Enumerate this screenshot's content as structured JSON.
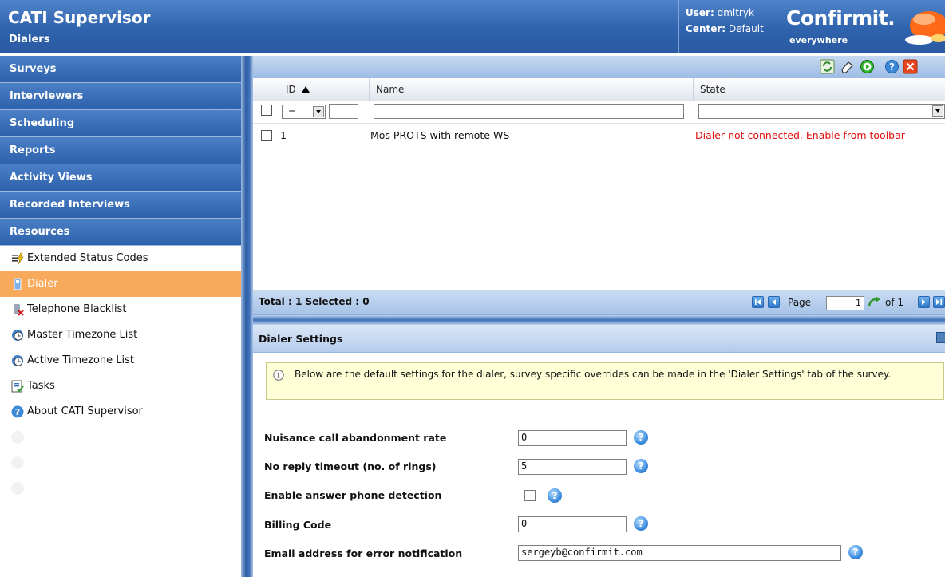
{
  "header": {
    "title": "CATI Supervisor",
    "subtitle": "Dialers",
    "user_label": "User:",
    "user_value": "dmitryk",
    "center_label": "Center:",
    "center_value": "Default",
    "brand": "Confirmit.",
    "brand_tagline": "everywhere"
  },
  "sidebar": {
    "sections": [
      {
        "label": "Surveys"
      },
      {
        "label": "Interviewers"
      },
      {
        "label": "Scheduling"
      },
      {
        "label": "Reports"
      },
      {
        "label": "Activity Views"
      },
      {
        "label": "Recorded Interviews"
      },
      {
        "label": "Resources"
      }
    ],
    "resource_items": [
      {
        "label": "Extended Status Codes",
        "icon": "status-codes-icon"
      },
      {
        "label": "Dialer",
        "icon": "dialer-icon",
        "active": true
      },
      {
        "label": "Telephone Blacklist",
        "icon": "phone-blacklist-icon"
      },
      {
        "label": "Master Timezone List",
        "icon": "timezone-icon"
      },
      {
        "label": "Active Timezone List",
        "icon": "timezone-icon"
      },
      {
        "label": "Tasks",
        "icon": "tasks-icon"
      },
      {
        "label": "About CATI Supervisor",
        "icon": "help-icon"
      }
    ]
  },
  "toolbar": {
    "buttons": [
      "refresh-icon",
      "clear-icon",
      "start-icon",
      "help-icon",
      "close-icon"
    ]
  },
  "grid": {
    "columns": [
      {
        "label": "ID",
        "sort": "ascending"
      },
      {
        "label": "Name"
      },
      {
        "label": "State"
      }
    ],
    "filter": {
      "operator": "=",
      "id_value": "",
      "name_value": "",
      "state_value": ""
    },
    "rows": [
      {
        "id": "1",
        "name": "Mos PROTS with remote WS",
        "state": "Dialer not connected. Enable from toolbar"
      }
    ],
    "footer": {
      "summary": "Total : 1 Selected : 0",
      "page_label": "Page",
      "page_value": "1",
      "of_label": "of 1"
    }
  },
  "settings": {
    "title": "Dialer Settings",
    "info": "Below are the default settings for the dialer, survey specific overrides can be made in the 'Dialer Settings' tab of the survey.",
    "fields": [
      {
        "label": "Nuisance call abandonment rate",
        "value": "0"
      },
      {
        "label": "No reply timeout (no. of rings)",
        "value": "5"
      },
      {
        "label": "Enable answer phone detection",
        "checked": false
      },
      {
        "label": "Billing Code",
        "value": "0"
      },
      {
        "label": "Email address for error notification",
        "value": "sergeyb@confirmit.com"
      }
    ]
  },
  "colors": {
    "header_blue": "#2f63ad",
    "active_item": "#f7a95c",
    "error_text": "#e01010",
    "info_background": "#ffffd8"
  }
}
